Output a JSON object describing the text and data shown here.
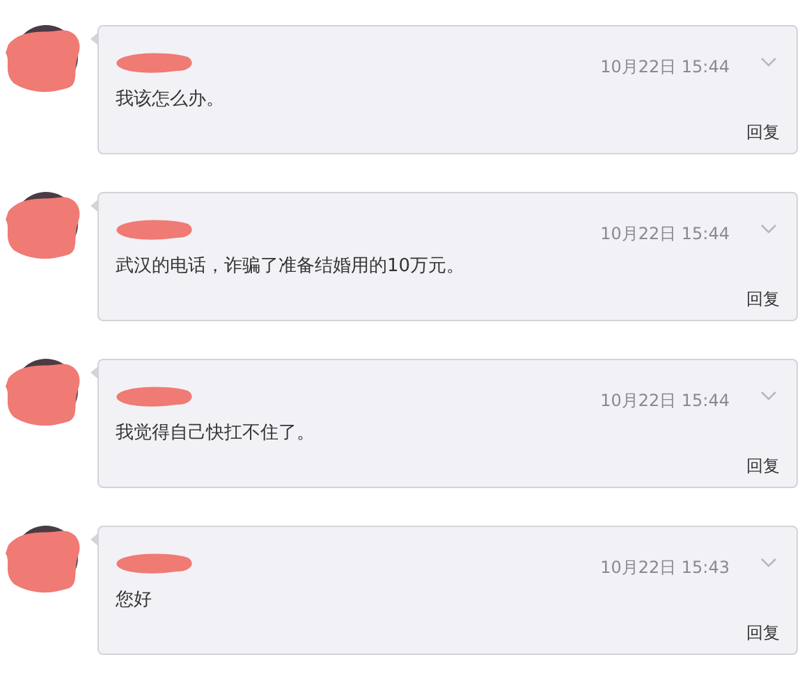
{
  "messages": [
    {
      "time": "10月22日 15:44",
      "text": "我该怎么办。",
      "reply": "回复"
    },
    {
      "time": "10月22日 15:44",
      "text": "武汉的电话，诈骗了准备结婚用的10万元。",
      "reply": "回复"
    },
    {
      "time": "10月22日 15:44",
      "text": "我觉得自己快扛不住了。",
      "reply": "回复"
    },
    {
      "time": "10月22日 15:43",
      "text": "您好",
      "reply": "回复"
    }
  ]
}
